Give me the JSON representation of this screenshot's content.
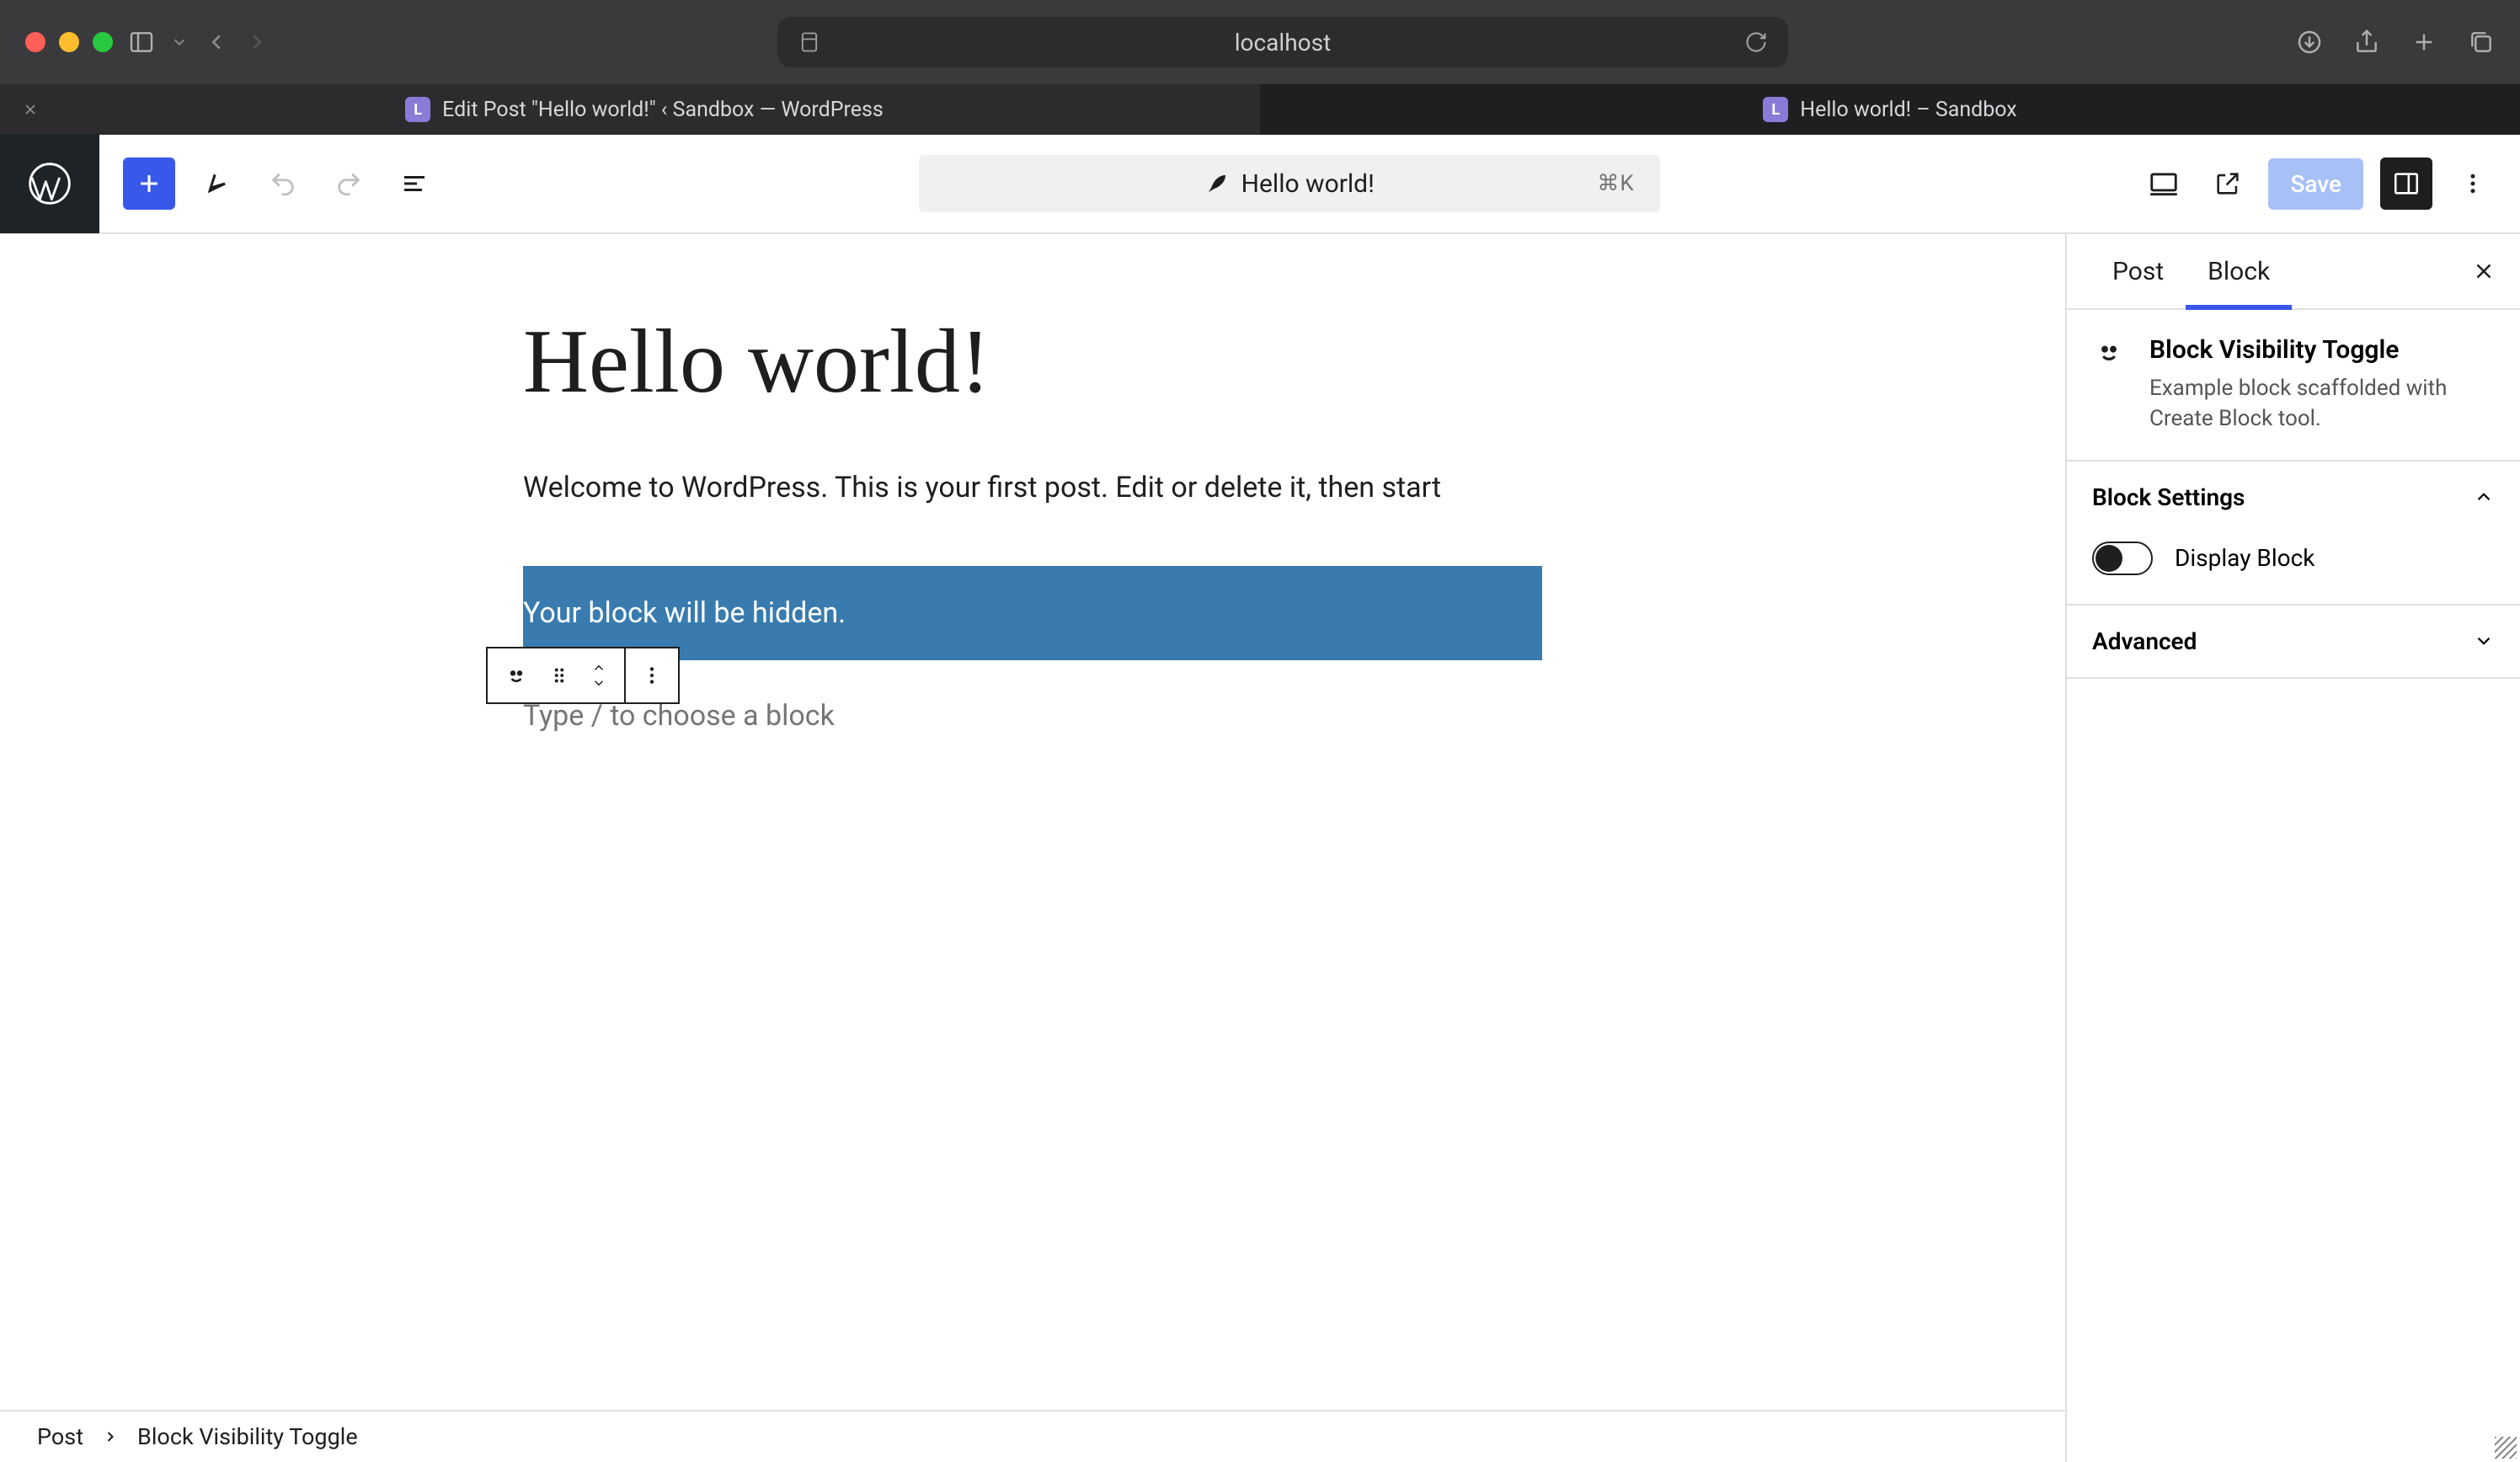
{
  "browser": {
    "address": "localhost",
    "tabs": [
      {
        "favicon_letter": "L",
        "label": "Edit Post \"Hello world!\" ‹ Sandbox — WordPress"
      },
      {
        "favicon_letter": "L",
        "label": "Hello world! – Sandbox"
      }
    ]
  },
  "topbar": {
    "doc_title": "Hello world!",
    "shortcut": "⌘K",
    "save_label": "Save"
  },
  "canvas": {
    "post_title": "Hello world!",
    "paragraph": "Welcome to WordPress. This is your first post. Edit or delete it, then start",
    "selected_block_text": "Your block will be hidden.",
    "new_block_placeholder": "Type / to choose a block"
  },
  "sidebar": {
    "tabs": {
      "post": "Post",
      "block": "Block"
    },
    "block_card": {
      "title": "Block Visibility Toggle",
      "description": "Example block scaffolded with Create Block tool."
    },
    "sections": {
      "block_settings_label": "Block Settings",
      "display_block_label": "Display Block",
      "advanced_label": "Advanced"
    }
  },
  "breadcrumb": {
    "root": "Post",
    "current": "Block Visibility Toggle"
  }
}
